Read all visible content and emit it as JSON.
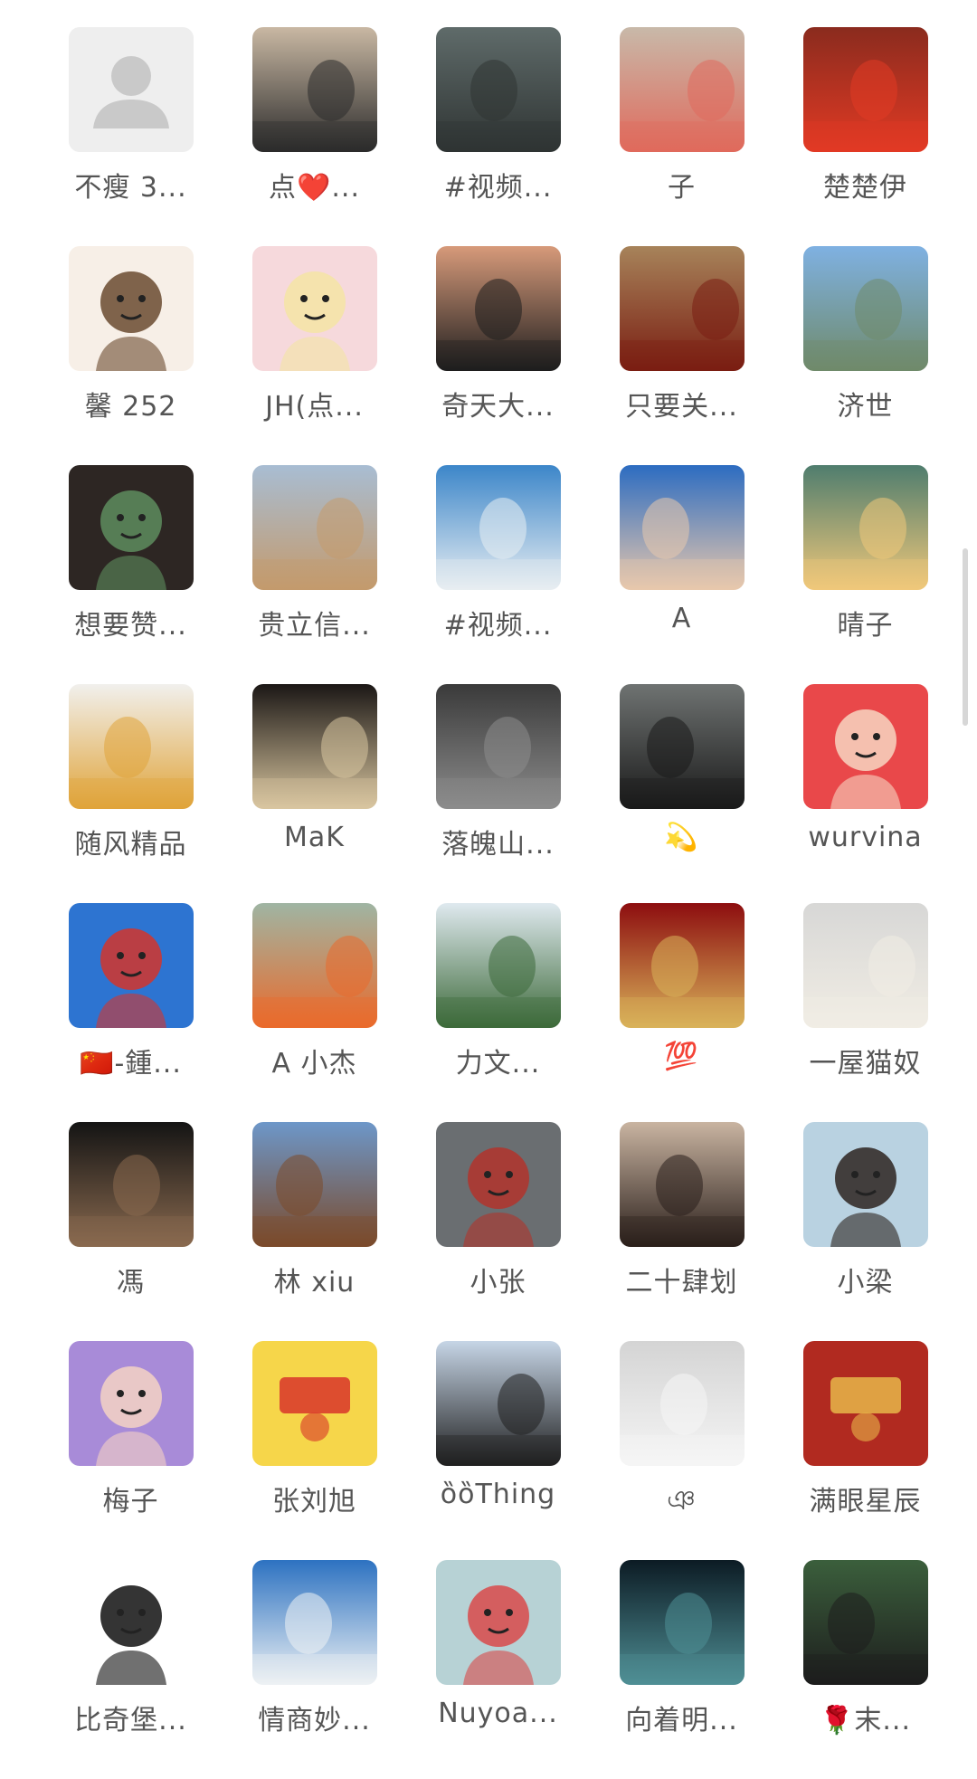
{
  "members": [
    {
      "name": "不瘦 3...",
      "bg": "#eeeeee",
      "kind": "placeholder",
      "icon": "person-placeholder-icon"
    },
    {
      "name": "点❤️...",
      "bg": "#c9b8a3",
      "kind": "photo",
      "accent": "#2b2b2b"
    },
    {
      "name": "#视频...",
      "bg": "#5f6b6a",
      "kind": "photo",
      "accent": "#2f3433"
    },
    {
      "name": "子",
      "bg": "#c8b9a9",
      "kind": "photo",
      "accent": "#e06a5c"
    },
    {
      "name": "楚楚伊",
      "bg": "#8a2b1e",
      "kind": "photo",
      "accent": "#e23a24"
    },
    {
      "name": "馨 252",
      "bg": "#f7efe7",
      "kind": "cartoon",
      "accent": "#6a4a2f"
    },
    {
      "name": "JH(点...",
      "bg": "#f6d9dc",
      "kind": "cartoon",
      "accent": "#f4e4a4"
    },
    {
      "name": "奇天大...",
      "bg": "#d79a7a",
      "kind": "photo",
      "accent": "#1e1e1e"
    },
    {
      "name": "只要关...",
      "bg": "#a7835a",
      "kind": "photo",
      "accent": "#7a1e12"
    },
    {
      "name": "济世",
      "bg": "#7fb1e2",
      "kind": "photo",
      "accent": "#6f8a6a"
    },
    {
      "name": "想要赞...",
      "bg": "#2d2623",
      "kind": "cartoon",
      "accent": "#5e8d5e"
    },
    {
      "name": "贵立信...",
      "bg": "#a8bdd3",
      "kind": "photo",
      "accent": "#c49a6c"
    },
    {
      "name": "#视频...",
      "bg": "#3c86c9",
      "kind": "photo",
      "accent": "#e8eef2"
    },
    {
      "name": "A",
      "bg": "#2c6cc1",
      "kind": "photo",
      "accent": "#e8c8ad"
    },
    {
      "name": "晴子",
      "bg": "#4f7d6e",
      "kind": "photo",
      "accent": "#f0c87a"
    },
    {
      "name": "随风精品",
      "bg": "#f1f0ed",
      "kind": "photo",
      "accent": "#e0a43a"
    },
    {
      "name": "MaK",
      "bg": "#1b1715",
      "kind": "photo",
      "accent": "#d9c6a0"
    },
    {
      "name": "落魄山...",
      "bg": "#3a3a3a",
      "kind": "photo",
      "accent": "#8c8c8c"
    },
    {
      "name": "💫",
      "bg": "#6f7372",
      "kind": "photo",
      "accent": "#1a1a1a"
    },
    {
      "name": "wurvina",
      "bg": "#e9484a",
      "kind": "cartoon",
      "accent": "#f7d6c1"
    },
    {
      "name": "🇨🇳-鍾...",
      "bg": "#2d74d1",
      "kind": "cartoon",
      "accent": "#d3352b"
    },
    {
      "name": "A 小杰",
      "bg": "#9fb5a3",
      "kind": "photo",
      "accent": "#ea6a2b"
    },
    {
      "name": "力文...",
      "bg": "#dfe9ef",
      "kind": "photo",
      "accent": "#3d6a3a"
    },
    {
      "name": "💯",
      "bg": "#8d0d0f",
      "kind": "photo",
      "accent": "#d9b35a"
    },
    {
      "name": "一屋猫奴",
      "bg": "#d7d7d6",
      "kind": "photo",
      "accent": "#f1ede4"
    },
    {
      "name": "馮",
      "bg": "#141414",
      "kind": "photo",
      "accent": "#8a6a4f"
    },
    {
      "name": "林 xiu",
      "bg": "#6d97c9",
      "kind": "photo",
      "accent": "#7b4a2a"
    },
    {
      "name": "小张",
      "bg": "#6a6e71",
      "kind": "cartoon",
      "accent": "#b1342c"
    },
    {
      "name": "二十肆划",
      "bg": "#c9b4a1",
      "kind": "photo",
      "accent": "#2a1f1b"
    },
    {
      "name": "小梁",
      "bg": "#b9d2e1",
      "kind": "cartoon",
      "accent": "#2d2420"
    },
    {
      "name": "梅子",
      "bg": "#a88bd8",
      "kind": "cartoon",
      "accent": "#f5d2c4"
    },
    {
      "name": "张刘旭",
      "bg": "#f6d64a",
      "kind": "logo",
      "accent": "#d8352a"
    },
    {
      "name": "ȍȍThing",
      "bg": "#c6d5e6",
      "kind": "photo",
      "accent": "#1f1f1f"
    },
    {
      "name": "ঞ",
      "bg": "#d4d4d4",
      "kind": "photo",
      "accent": "#f5f5f5"
    },
    {
      "name": "满眼星辰",
      "bg": "#b12a20",
      "kind": "logo",
      "accent": "#e8b64a"
    },
    {
      "name": "比奇堡...",
      "bg": "#ffffff",
      "kind": "cartoon",
      "accent": "#111111"
    },
    {
      "name": "情商妙...",
      "bg": "#2d72c1",
      "kind": "photo",
      "accent": "#eef2f4"
    },
    {
      "name": "Nuyoa...",
      "bg": "#b7d2d5",
      "kind": "cartoon",
      "accent": "#d94a4a"
    },
    {
      "name": "向着明...",
      "bg": "#0c1b24",
      "kind": "photo",
      "accent": "#4f8f95"
    },
    {
      "name": "🌹末...",
      "bg": "#3b5f3c",
      "kind": "photo",
      "accent": "#1d1d1d"
    }
  ]
}
